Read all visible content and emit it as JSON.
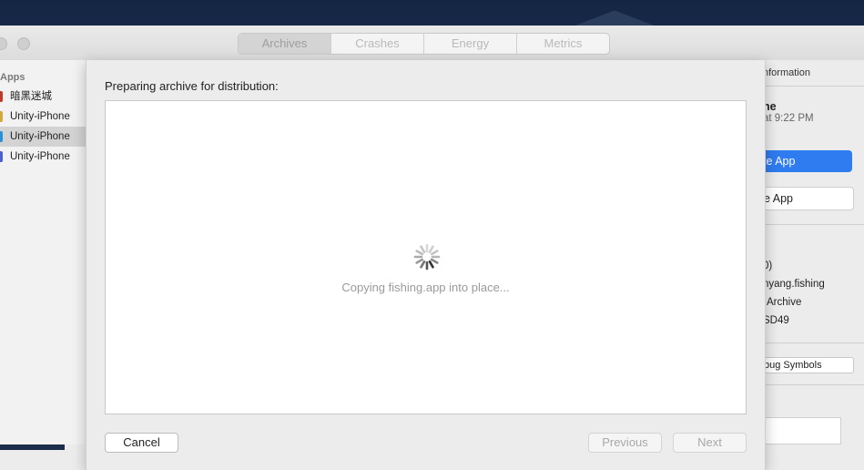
{
  "toolbar": {
    "tabs": [
      {
        "label": "Archives",
        "active": true
      },
      {
        "label": "Crashes",
        "active": false
      },
      {
        "label": "Energy",
        "active": false
      },
      {
        "label": "Metrics",
        "active": false
      }
    ]
  },
  "sidebar": {
    "header": "Apps",
    "items": [
      {
        "label": "暗黑迷城",
        "icon_color": "#c0392b",
        "selected": false
      },
      {
        "label": "Unity-iPhone",
        "icon_color": "#d4a93a",
        "selected": false
      },
      {
        "label": "Unity-iPhone",
        "icon_color": "#2a8fd6",
        "selected": true
      },
      {
        "label": "Unity-iPhone",
        "icon_color": "#4a5fd0",
        "selected": false
      }
    ]
  },
  "right_panel": {
    "section_title": "nformation",
    "name": "ne",
    "date": "at 9:22 PM",
    "primary_button": "te App",
    "secondary_button": "e App",
    "version": "0)",
    "identifier": "nyang.fishing",
    "type": "Archive",
    "team": "SD49",
    "debug_button": "bug Symbols"
  },
  "sheet": {
    "heading": "Preparing archive for distribution:",
    "status": "Copying fishing.app into place...",
    "cancel_label": "Cancel",
    "previous_label": "Previous",
    "next_label": "Next"
  },
  "colors": {
    "accent": "#2f7bf0"
  }
}
